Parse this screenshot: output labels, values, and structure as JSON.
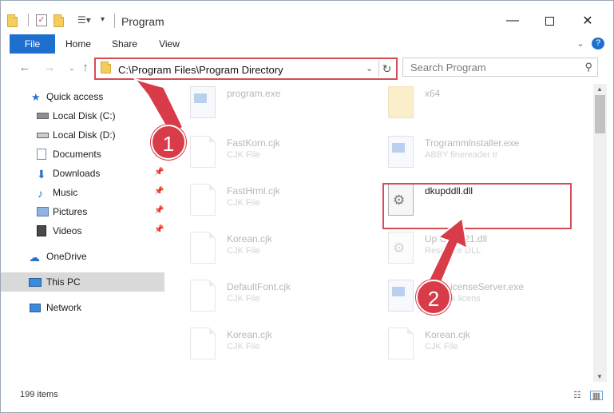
{
  "window": {
    "title": "Program"
  },
  "ribbon": {
    "tabs": [
      "File",
      "Home",
      "Share",
      "View"
    ]
  },
  "address": {
    "path": "C:\\Program Files\\Program Directory"
  },
  "search": {
    "placeholder": "Search Program"
  },
  "nav": {
    "items": [
      {
        "label": "Quick access",
        "icon": "star-icon"
      },
      {
        "label": "Local Disk (C:)",
        "icon": "drive-icon"
      },
      {
        "label": "Local Disk (D:)",
        "icon": "drive-icon"
      },
      {
        "label": "Documents",
        "icon": "documents-icon",
        "pinned": true
      },
      {
        "label": "Downloads",
        "icon": "download-arrow-icon",
        "pinned": true
      },
      {
        "label": "Music",
        "icon": "music-note-icon",
        "pinned": true
      },
      {
        "label": "Pictures",
        "icon": "pictures-icon",
        "pinned": true
      },
      {
        "label": "Videos",
        "icon": "film-icon",
        "pinned": true
      },
      {
        "label": "OneDrive",
        "icon": "cloud-icon"
      },
      {
        "label": "This PC",
        "icon": "monitor-icon",
        "selected": true
      },
      {
        "label": "Network",
        "icon": "network-icon"
      }
    ]
  },
  "files": [
    {
      "name": "program.exe",
      "type": "",
      "icon": "exe-icon"
    },
    {
      "name": "x64",
      "type": "",
      "icon": "folder-icon"
    },
    {
      "name": "FastKorn.cjk",
      "type": "CJK File",
      "icon": "document-icon"
    },
    {
      "name": "Trogrammlnstaller.exe",
      "type": "ABBY finereader tr",
      "icon": "exe-icon"
    },
    {
      "name": "FastHrml.cjk",
      "type": "CJK File",
      "icon": "document-icon"
    },
    {
      "name": "dkupddll.dll",
      "type": "",
      "icon": "dll-gear-icon",
      "highlighted": true
    },
    {
      "name": "Korean.cjk",
      "type": "CJK File",
      "icon": "document-icon"
    },
    {
      "name": "Up Client21.dll",
      "type": "Resource DLL",
      "icon": "dll-gear-icon"
    },
    {
      "name": "DefaultFont.cjk",
      "type": "CJK File",
      "icon": "document-icon"
    },
    {
      "name": "workLicenseServer.exe",
      "type": "network licens",
      "icon": "exe-icon"
    },
    {
      "name": "Korean.cjk",
      "type": "CJK File",
      "icon": "document-icon"
    },
    {
      "name": "Korean.cjk",
      "type": "CJK File",
      "icon": "document-icon"
    }
  ],
  "status": {
    "count": "199 items"
  },
  "annotations": {
    "marker1": "1",
    "marker2": "2",
    "color": "#d73c48"
  }
}
